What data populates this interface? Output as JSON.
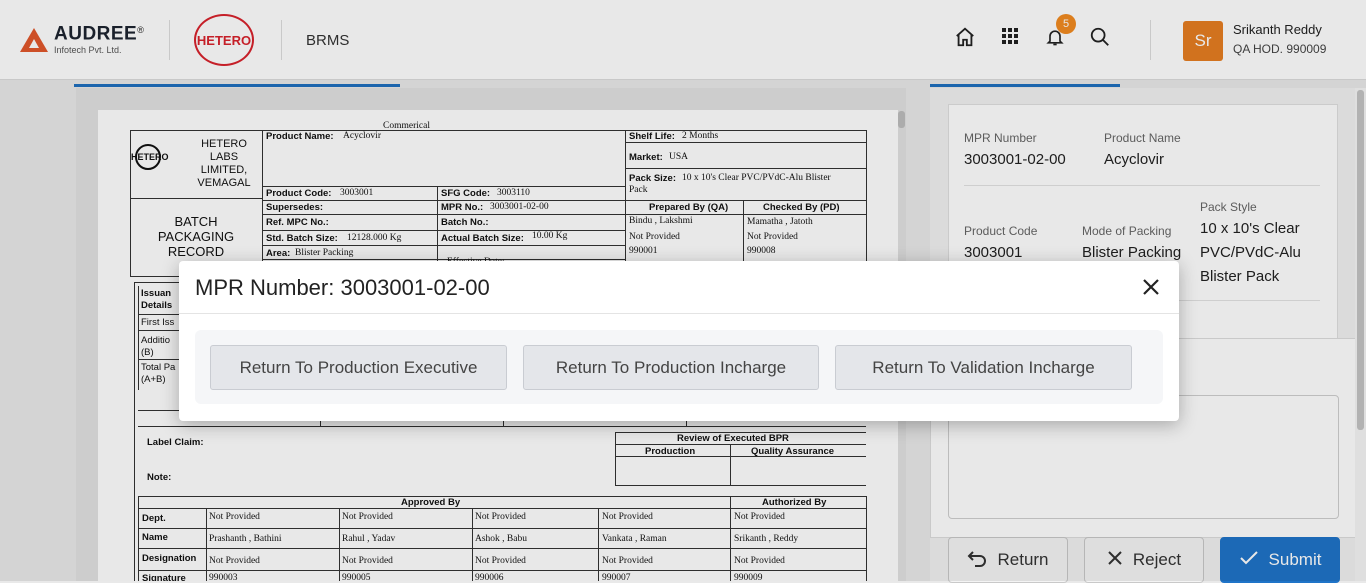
{
  "header": {
    "brand_name": "AUDREE",
    "brand_reg": "®",
    "brand_sub": "Infotech Pvt. Ltd.",
    "client_logo": "HETERO",
    "app_name": "BRMS",
    "notification_count": "5",
    "user_initials": "Sr",
    "user_name": "Srikanth Reddy",
    "user_role": "QA HOD. 990009",
    "icons": [
      "home-icon",
      "apps-grid-icon",
      "bell-icon",
      "search-icon"
    ]
  },
  "document": {
    "commercial": "Commerical",
    "company_logo": "HETERO",
    "company_name_1": "HETERO",
    "company_name_2": "LABS",
    "company_name_3": "LIMITED,",
    "company_name_4": "VEMAGAL",
    "record_title_1": "BATCH",
    "record_title_2": "PACKAGING",
    "record_title_3": "RECORD",
    "product_name_label": "Product Name:",
    "product_name": "Acyclovir",
    "shelf_life_label": "Shelf Life:",
    "shelf_life": "2 Months",
    "market_label": "Market:",
    "market": "USA",
    "pack_size_label": "Pack Size:",
    "pack_size_1": "10 x 10's Clear PVC/PVdC-Alu Blister",
    "pack_size_2": "Pack",
    "product_code_label": "Product Code:",
    "product_code": "3003001",
    "sfg_code_label": "SFG Code:",
    "sfg_code": "3003110",
    "supersedes_label": "Supersedes:",
    "mpr_no_label": "MPR No.:",
    "mpr_no": "3003001-02-00",
    "prepared_by_label": "Prepared By (QA)",
    "checked_by_label": "Checked By (PD)",
    "ref_mpc_label": "Ref. MPC No.:",
    "batch_no_label": "Batch No.:",
    "prepared_name": "Bindu , Lakshmi",
    "checked_name": "Mamatha , Jatoth",
    "std_batch_label": "Std. Batch Size:",
    "std_batch": "12128.000 Kg",
    "actual_batch_label": "Actual Batch Size:",
    "actual_batch": "10.00 Kg",
    "not_provided": "Not Provided",
    "prepared_id": "990001",
    "checked_id": "990008",
    "area_label": "Area:",
    "area": "Blister Packing",
    "effective_date": "Effective Date:",
    "issuance_1": "Issuan",
    "issuance_2": "Details",
    "first_iss": "First Iss",
    "addition_1": "Additio",
    "addition_2": "(B)",
    "total_1": "Total Pa",
    "total_2": "(A+B)",
    "label_claim": "Label Claim:",
    "note": "Note:",
    "review_label": "Review of Executed BPR",
    "production_label": "Production",
    "qa_label": "Quality Assurance",
    "approved_by": "Approved By",
    "authorized_by": "Authorized By",
    "dept": "Dept.",
    "name": "Name",
    "designation": "Designation",
    "signature": "Signature",
    "names": [
      "Prashanth , Bathini",
      "Rahul , Yadav",
      "Ashok , Babu",
      "Vankata , Raman",
      "Srikanth , Reddy"
    ],
    "ids": [
      "990003",
      "990005",
      "990006",
      "990007",
      "990009"
    ]
  },
  "info": {
    "mpr_number_label": "MPR Number",
    "mpr_number": "3003001-02-00",
    "product_name_label": "Product Name",
    "product_name": "Acyclovir",
    "product_code_label": "Product Code",
    "product_code": "3003001",
    "mode_label": "Mode of Packing",
    "mode": "Blister Packing",
    "pack_style_label": "Pack Style",
    "pack_style_1": "10 x 10's Clear",
    "pack_style_2": "PVC/PVdC-Alu",
    "pack_style_3": "Blister Pack"
  },
  "actions": {
    "return_label": "Return",
    "reject_label": "Reject",
    "submit_label": "Submit"
  },
  "modal": {
    "title": "MPR Number: 3003001-02-00",
    "options": [
      "Return To Production Executive",
      "Return To Production Incharge",
      "Return To Validation Incharge"
    ]
  },
  "colors": {
    "accent_blue": "#1f74c8",
    "badge_orange": "#f28b20",
    "avatar_orange": "#e67e22",
    "hetero_red": "#d9232d"
  }
}
